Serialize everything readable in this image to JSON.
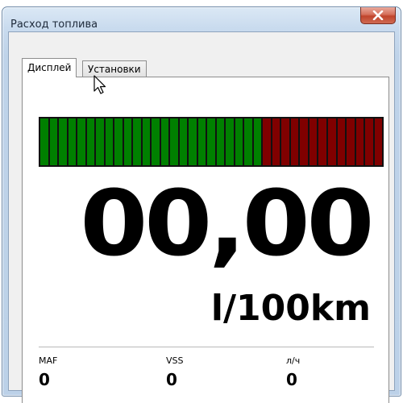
{
  "window": {
    "title": "Расход топлива",
    "close_icon": "close-icon"
  },
  "tabs": [
    {
      "label": "Дисплей",
      "active": true
    },
    {
      "label": "Установки",
      "active": false
    }
  ],
  "bargraph": {
    "green_segments": 24,
    "red_segments": 13,
    "green_color": "#008000",
    "red_color": "#800000"
  },
  "display": {
    "value": "00,00",
    "unit": "l/100km"
  },
  "stats": [
    {
      "label": "MAF",
      "value": "0"
    },
    {
      "label": "VSS",
      "value": "0"
    },
    {
      "label": "л/ч",
      "value": "0"
    }
  ]
}
